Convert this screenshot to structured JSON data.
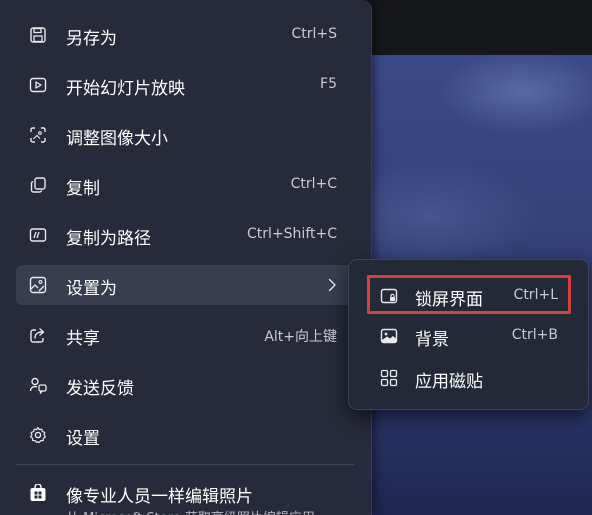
{
  "menu": {
    "items": [
      {
        "label": "另存为",
        "shortcut": "Ctrl+S",
        "icon": "save-icon"
      },
      {
        "label": "开始幻灯片放映",
        "shortcut": "F5",
        "icon": "slideshow-icon"
      },
      {
        "label": "调整图像大小",
        "shortcut": "",
        "icon": "resize-image-icon"
      },
      {
        "label": "复制",
        "shortcut": "Ctrl+C",
        "icon": "copy-icon"
      },
      {
        "label": "复制为路径",
        "shortcut": "Ctrl+Shift+C",
        "icon": "copy-path-icon"
      },
      {
        "label": "设置为",
        "shortcut": "",
        "icon": "set-as-icon"
      },
      {
        "label": "共享",
        "shortcut": "Alt+向上键",
        "icon": "share-icon"
      },
      {
        "label": "发送反馈",
        "shortcut": "",
        "icon": "feedback-icon"
      },
      {
        "label": "设置",
        "shortcut": "",
        "icon": "settings-icon"
      }
    ],
    "store": {
      "title": "像专业人员一样编辑照片",
      "subtitle": "从 Microsoft Store 获取高级照片编辑应用",
      "icon": "store-icon"
    }
  },
  "submenu": {
    "items": [
      {
        "label": "锁屏界面",
        "shortcut": "Ctrl+L",
        "icon": "lock-screen-icon"
      },
      {
        "label": "背景",
        "shortcut": "Ctrl+B",
        "icon": "background-icon"
      },
      {
        "label": "应用磁贴",
        "shortcut": "",
        "icon": "app-tile-icon"
      }
    ]
  },
  "colors": {
    "menu_bg": "#262a3a",
    "active_item_bg": "#383d50",
    "highlight_border": "#d2403f"
  }
}
